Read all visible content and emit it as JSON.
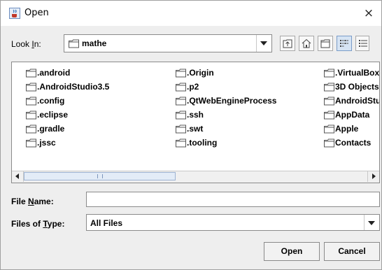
{
  "window": {
    "title": "Open",
    "close_glyph": "×",
    "icon": "java-cup-icon"
  },
  "look_in": {
    "label_prefix": "Look ",
    "label_mnemonic": "I",
    "label_suffix": "n:",
    "value": "mathe"
  },
  "toolbar": {
    "buttons": [
      "up-one-level-icon",
      "home-icon",
      "new-folder-icon",
      "list-view-icon",
      "details-view-icon"
    ],
    "active": "list-view-icon"
  },
  "files": {
    "columns": [
      [
        ".android",
        ".AndroidStudio3.5",
        ".config",
        ".eclipse",
        ".gradle",
        ".jssc"
      ],
      [
        ".Origin",
        ".p2",
        ".QtWebEngineProcess",
        ".ssh",
        ".swt",
        ".tooling"
      ],
      [
        ".VirtualBox",
        "3D Objects",
        "AndroidStudioProjects",
        "AppData",
        "Apple",
        "Contacts"
      ]
    ]
  },
  "file_name": {
    "label_prefix": "File ",
    "label_mnemonic": "N",
    "label_suffix": "ame:",
    "value": ""
  },
  "file_type": {
    "label_prefix": "Files of ",
    "label_mnemonic": "T",
    "label_suffix": "ype:",
    "value": "All Files"
  },
  "buttons": {
    "open": "Open",
    "cancel": "Cancel"
  },
  "colors": {
    "selection": "#d6e4f4",
    "border": "#8a8a8a",
    "background": "#eeeeee"
  }
}
